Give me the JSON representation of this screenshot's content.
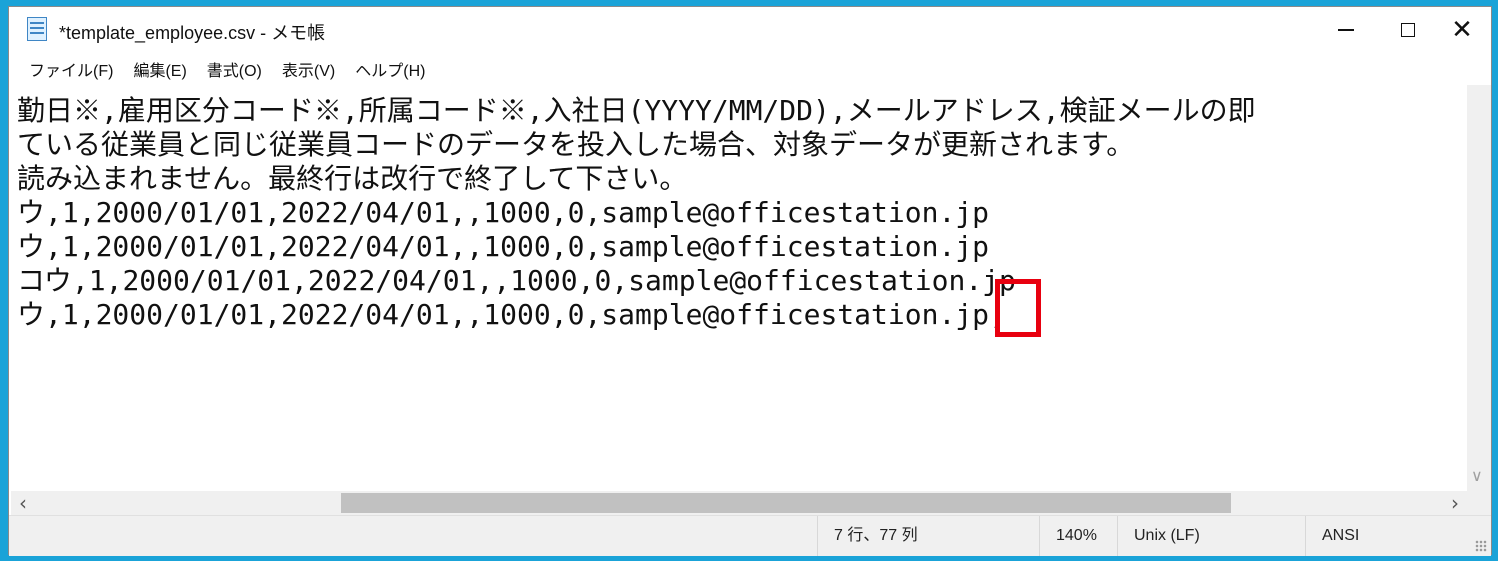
{
  "window": {
    "title": "*template_employee.csv - メモ帳",
    "icon": "notepad-icon"
  },
  "menu": [
    {
      "label": "ファイル(F)"
    },
    {
      "label": "編集(E)"
    },
    {
      "label": "書式(O)"
    },
    {
      "label": "表示(V)"
    },
    {
      "label": "ヘルプ(H)"
    }
  ],
  "editor": {
    "lines": [
      "勤日※,雇用区分コード※,所属コード※,入社日(YYYY/MM/DD),メールアドレス,検証メールの即",
      "ている従業員と同じ従業員コードのデータを投入した場合、対象データが更新されます。",
      "読み込まれません。最終行は改行で終了して下さい。",
      "ウ,1,2000/01/01,2022/04/01,,1000,0,sample@officestation.jp",
      "ウ,1,2000/01/01,2022/04/01,,1000,0,sample@officestation.jp",
      "コウ,1,2000/01/01,2022/04/01,,1000,0,sample@officestation.jp",
      "ウ,1,2000/01/01,2022/04/01,,1000,0,sample@officestation.jp,"
    ],
    "highlight_color": "#e8000f"
  },
  "status": {
    "position": "7 行、77 列",
    "zoom": "140%",
    "line_ending": "Unix (LF)",
    "encoding": "ANSI"
  }
}
